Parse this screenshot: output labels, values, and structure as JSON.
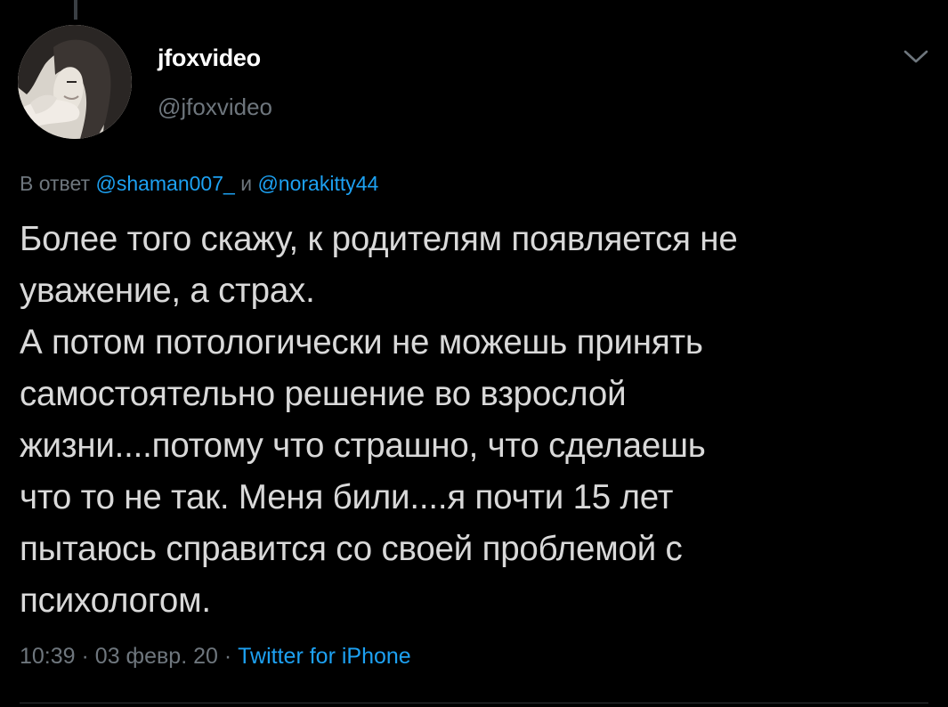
{
  "tweet": {
    "author": {
      "display_name": "jfoxvideo",
      "handle": "@jfoxvideo"
    },
    "reply": {
      "prefix": "В ответ",
      "mention1": "@shaman007_",
      "conjunction": "и",
      "mention2": "@norakitty44"
    },
    "text": "Более того скажу, к родителям появляется не\nуважение, а страх.\nА потом потологически не можешь принять\nсамостоятельно решение во взрослой\nжизни....потому что страшно, что сделаешь\nчто то не так. Меня били....я почти 15 лет\nпытаюсь справится со своей проблемой с\nпсихологом.",
    "meta": {
      "time": "10:39",
      "separator": "·",
      "date": "03 февр. 20",
      "source": "Twitter for iPhone"
    }
  },
  "icons": {
    "menu": "chevron-down-icon"
  },
  "colors": {
    "background": "#000000",
    "text": "#d9d9d9",
    "secondary": "#6e767d",
    "accent": "#1da1f2"
  }
}
